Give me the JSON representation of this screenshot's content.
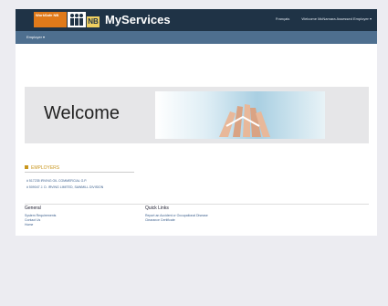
{
  "header": {
    "logo_text": "WorkSafe NB",
    "logo_badge": "NB",
    "app_title": "MyServices",
    "language_link": "Français",
    "user_menu": "Welcome McNamara Assessed Employer ▾"
  },
  "nav": {
    "menu_label": "Employer ▾"
  },
  "banner": {
    "title": "Welcome"
  },
  "employers": {
    "heading": "EMPLOYERS",
    "items": [
      "# 517235 IRVING OIL COMMERCIAL G.P.",
      "# 509047 J. D. IRVING LIMITED, SAWMILL DIVISION"
    ]
  },
  "general": {
    "heading": "General",
    "links": [
      "System Requirements",
      "Contact Us",
      "Home"
    ]
  },
  "quick_links": {
    "heading": "Quick Links",
    "links": [
      "Report an Accident or Occupational Disease",
      "Clearance Certificate"
    ]
  },
  "colors": {
    "header_bg": "#1f3346",
    "subbar_bg": "#4e6f8f",
    "accent": "#c9961e",
    "link": "#3a5e8c"
  }
}
